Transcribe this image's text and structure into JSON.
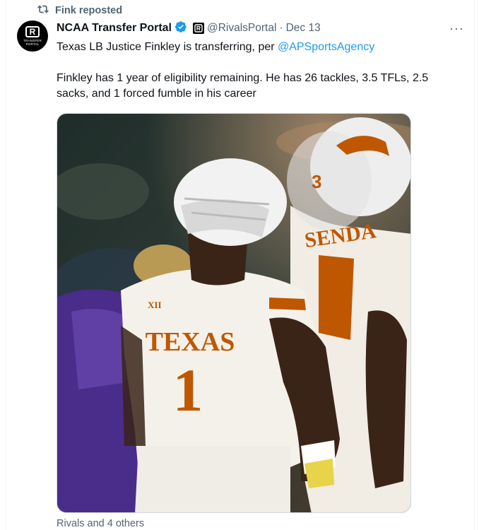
{
  "repost": {
    "label": "Fink reposted",
    "icon": "repost-icon"
  },
  "author": {
    "display_name": "NCAA Transfer Portal",
    "handle": "@RivalsPortal",
    "separator": "·",
    "date": "Dec 13",
    "avatar_text": "TRANSFER PORTAL",
    "avatar_letter": "R",
    "verified_color": "#1d9bf0"
  },
  "tweet": {
    "line1_prefix": "Texas LB Justice Finkley is transferring, per ",
    "line1_mention": "@APSportsAgency",
    "line2": "Finkley has 1 year of eligibility remaining. He has 26 tackles, 3.5 TFLs, 2.5 sacks, and 1 forced fumble in his career"
  },
  "media": {
    "jersey_text": "TEXAS",
    "jersey_number": "1",
    "teammate_jersey_text": "SENDA",
    "teammate_number": "3",
    "conference_mark": "XII",
    "helmet_number": "3",
    "accent_color": "#bf5700"
  },
  "social_context": "Rivals and 4 others",
  "more_icon": "···"
}
